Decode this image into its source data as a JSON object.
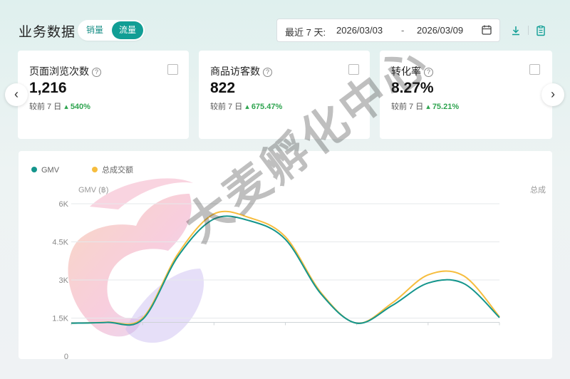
{
  "header": {
    "title": "业务数据",
    "toggle": {
      "sales": "销量",
      "traffic": "流量"
    },
    "date_range": {
      "label": "最近 7 天:",
      "start": "2026/03/03",
      "separator": "-",
      "end": "2026/03/09"
    }
  },
  "metrics": [
    {
      "title": "页面浏览次数",
      "value": "1,216",
      "compare_label": "较前 7 日",
      "change": "540%"
    },
    {
      "title": "商品访客数",
      "value": "822",
      "compare_label": "较前 7 日",
      "change": "675.47%"
    },
    {
      "title": "转化率",
      "value": "8.27%",
      "compare_label": "较前 7 日",
      "change": "75.21%"
    }
  ],
  "colors": {
    "accent": "#119e95",
    "gmv_line": "#14958c",
    "total_line": "#f6bd3e",
    "up": "#2ea44f"
  },
  "watermark": "大麦孵化中心",
  "chart_data": {
    "type": "line",
    "legend": [
      "GMV",
      "总成交额"
    ],
    "ylabel": "GMV (฿)",
    "y2label": "总成",
    "yticks": [
      "6K",
      "4.5K",
      "3K",
      "1.5K",
      "0"
    ],
    "ylim": [
      0,
      6000
    ],
    "x": [
      0,
      0.5,
      1,
      1.5,
      2,
      2.5,
      3,
      3.5,
      4,
      4.5,
      5,
      5.5,
      6
    ],
    "series": [
      {
        "name": "GMV",
        "values": [
          1300,
          1330,
          1450,
          3950,
          5400,
          5330,
          4600,
          2450,
          1300,
          2000,
          2880,
          2860,
          1520
        ]
      },
      {
        "name": "总成交额",
        "values": [
          1300,
          1340,
          1500,
          4050,
          5600,
          5450,
          4700,
          2500,
          1300,
          2100,
          3200,
          3160,
          1550
        ]
      }
    ]
  }
}
